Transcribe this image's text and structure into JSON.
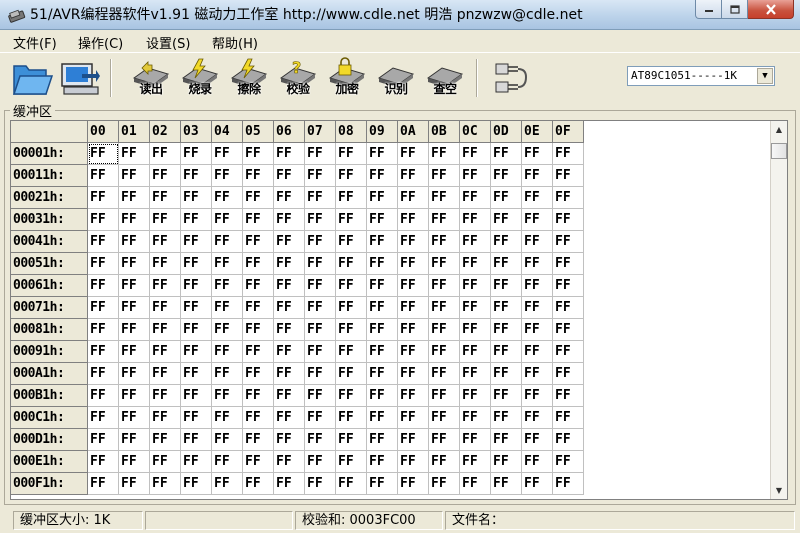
{
  "window": {
    "title": "51/AVR编程器软件v1.91  磁动力工作室 http://www.cdle.net    明浩   pnzwzw@cdle.net"
  },
  "menu": [
    {
      "label": "文件",
      "key": "(F)"
    },
    {
      "label": "操作",
      "key": "(C)"
    },
    {
      "label": "设置",
      "key": "(S)"
    },
    {
      "label": "帮助",
      "key": "(H)"
    }
  ],
  "toolbar": {
    "open_icon": "folder-open-icon",
    "save_icon": "computer-save-icon",
    "buttons": [
      {
        "label": "读出",
        "icon": "chip-read-icon"
      },
      {
        "label": "烧录",
        "icon": "chip-write-icon"
      },
      {
        "label": "擦除",
        "icon": "chip-erase-icon"
      },
      {
        "label": "校验",
        "icon": "chip-verify-icon"
      },
      {
        "label": "加密",
        "icon": "chip-lock-icon"
      },
      {
        "label": "识别",
        "icon": "chip-identify-icon"
      },
      {
        "label": "查空",
        "icon": "chip-blank-check-icon"
      }
    ],
    "connect_icon": "port-connect-icon"
  },
  "chip_select": {
    "value": "AT89C1051-----1K"
  },
  "buffer": {
    "group_label": "缓冲区",
    "columns": [
      "00",
      "01",
      "02",
      "03",
      "04",
      "05",
      "06",
      "07",
      "08",
      "09",
      "0A",
      "0B",
      "0C",
      "0D",
      "0E",
      "0F"
    ],
    "rows": [
      {
        "addr": "00001h:",
        "cells": [
          "FF",
          "FF",
          "FF",
          "FF",
          "FF",
          "FF",
          "FF",
          "FF",
          "FF",
          "FF",
          "FF",
          "FF",
          "FF",
          "FF",
          "FF",
          "FF"
        ]
      },
      {
        "addr": "00011h:",
        "cells": [
          "FF",
          "FF",
          "FF",
          "FF",
          "FF",
          "FF",
          "FF",
          "FF",
          "FF",
          "FF",
          "FF",
          "FF",
          "FF",
          "FF",
          "FF",
          "FF"
        ]
      },
      {
        "addr": "00021h:",
        "cells": [
          "FF",
          "FF",
          "FF",
          "FF",
          "FF",
          "FF",
          "FF",
          "FF",
          "FF",
          "FF",
          "FF",
          "FF",
          "FF",
          "FF",
          "FF",
          "FF"
        ]
      },
      {
        "addr": "00031h:",
        "cells": [
          "FF",
          "FF",
          "FF",
          "FF",
          "FF",
          "FF",
          "FF",
          "FF",
          "FF",
          "FF",
          "FF",
          "FF",
          "FF",
          "FF",
          "FF",
          "FF"
        ]
      },
      {
        "addr": "00041h:",
        "cells": [
          "FF",
          "FF",
          "FF",
          "FF",
          "FF",
          "FF",
          "FF",
          "FF",
          "FF",
          "FF",
          "FF",
          "FF",
          "FF",
          "FF",
          "FF",
          "FF"
        ]
      },
      {
        "addr": "00051h:",
        "cells": [
          "FF",
          "FF",
          "FF",
          "FF",
          "FF",
          "FF",
          "FF",
          "FF",
          "FF",
          "FF",
          "FF",
          "FF",
          "FF",
          "FF",
          "FF",
          "FF"
        ]
      },
      {
        "addr": "00061h:",
        "cells": [
          "FF",
          "FF",
          "FF",
          "FF",
          "FF",
          "FF",
          "FF",
          "FF",
          "FF",
          "FF",
          "FF",
          "FF",
          "FF",
          "FF",
          "FF",
          "FF"
        ]
      },
      {
        "addr": "00071h:",
        "cells": [
          "FF",
          "FF",
          "FF",
          "FF",
          "FF",
          "FF",
          "FF",
          "FF",
          "FF",
          "FF",
          "FF",
          "FF",
          "FF",
          "FF",
          "FF",
          "FF"
        ]
      },
      {
        "addr": "00081h:",
        "cells": [
          "FF",
          "FF",
          "FF",
          "FF",
          "FF",
          "FF",
          "FF",
          "FF",
          "FF",
          "FF",
          "FF",
          "FF",
          "FF",
          "FF",
          "FF",
          "FF"
        ]
      },
      {
        "addr": "00091h:",
        "cells": [
          "FF",
          "FF",
          "FF",
          "FF",
          "FF",
          "FF",
          "FF",
          "FF",
          "FF",
          "FF",
          "FF",
          "FF",
          "FF",
          "FF",
          "FF",
          "FF"
        ]
      },
      {
        "addr": "000A1h:",
        "cells": [
          "FF",
          "FF",
          "FF",
          "FF",
          "FF",
          "FF",
          "FF",
          "FF",
          "FF",
          "FF",
          "FF",
          "FF",
          "FF",
          "FF",
          "FF",
          "FF"
        ]
      },
      {
        "addr": "000B1h:",
        "cells": [
          "FF",
          "FF",
          "FF",
          "FF",
          "FF",
          "FF",
          "FF",
          "FF",
          "FF",
          "FF",
          "FF",
          "FF",
          "FF",
          "FF",
          "FF",
          "FF"
        ]
      },
      {
        "addr": "000C1h:",
        "cells": [
          "FF",
          "FF",
          "FF",
          "FF",
          "FF",
          "FF",
          "FF",
          "FF",
          "FF",
          "FF",
          "FF",
          "FF",
          "FF",
          "FF",
          "FF",
          "FF"
        ]
      },
      {
        "addr": "000D1h:",
        "cells": [
          "FF",
          "FF",
          "FF",
          "FF",
          "FF",
          "FF",
          "FF",
          "FF",
          "FF",
          "FF",
          "FF",
          "FF",
          "FF",
          "FF",
          "FF",
          "FF"
        ]
      },
      {
        "addr": "000E1h:",
        "cells": [
          "FF",
          "FF",
          "FF",
          "FF",
          "FF",
          "FF",
          "FF",
          "FF",
          "FF",
          "FF",
          "FF",
          "FF",
          "FF",
          "FF",
          "FF",
          "FF"
        ]
      },
      {
        "addr": "000F1h:",
        "cells": [
          "FF",
          "FF",
          "FF",
          "FF",
          "FF",
          "FF",
          "FF",
          "FF",
          "FF",
          "FF",
          "FF",
          "FF",
          "FF",
          "FF",
          "FF",
          "FF"
        ]
      }
    ]
  },
  "statusbar": {
    "buffer_size": "缓冲区大小: 1K",
    "empty": "",
    "checksum": "校验和: 0003FC00",
    "filename": "文件名："
  },
  "colors": {
    "window_bg": "#ece9d8",
    "titlebar": "#bcd3ea",
    "close_button": "#c6402c",
    "grid_bg": "#ffffff"
  }
}
